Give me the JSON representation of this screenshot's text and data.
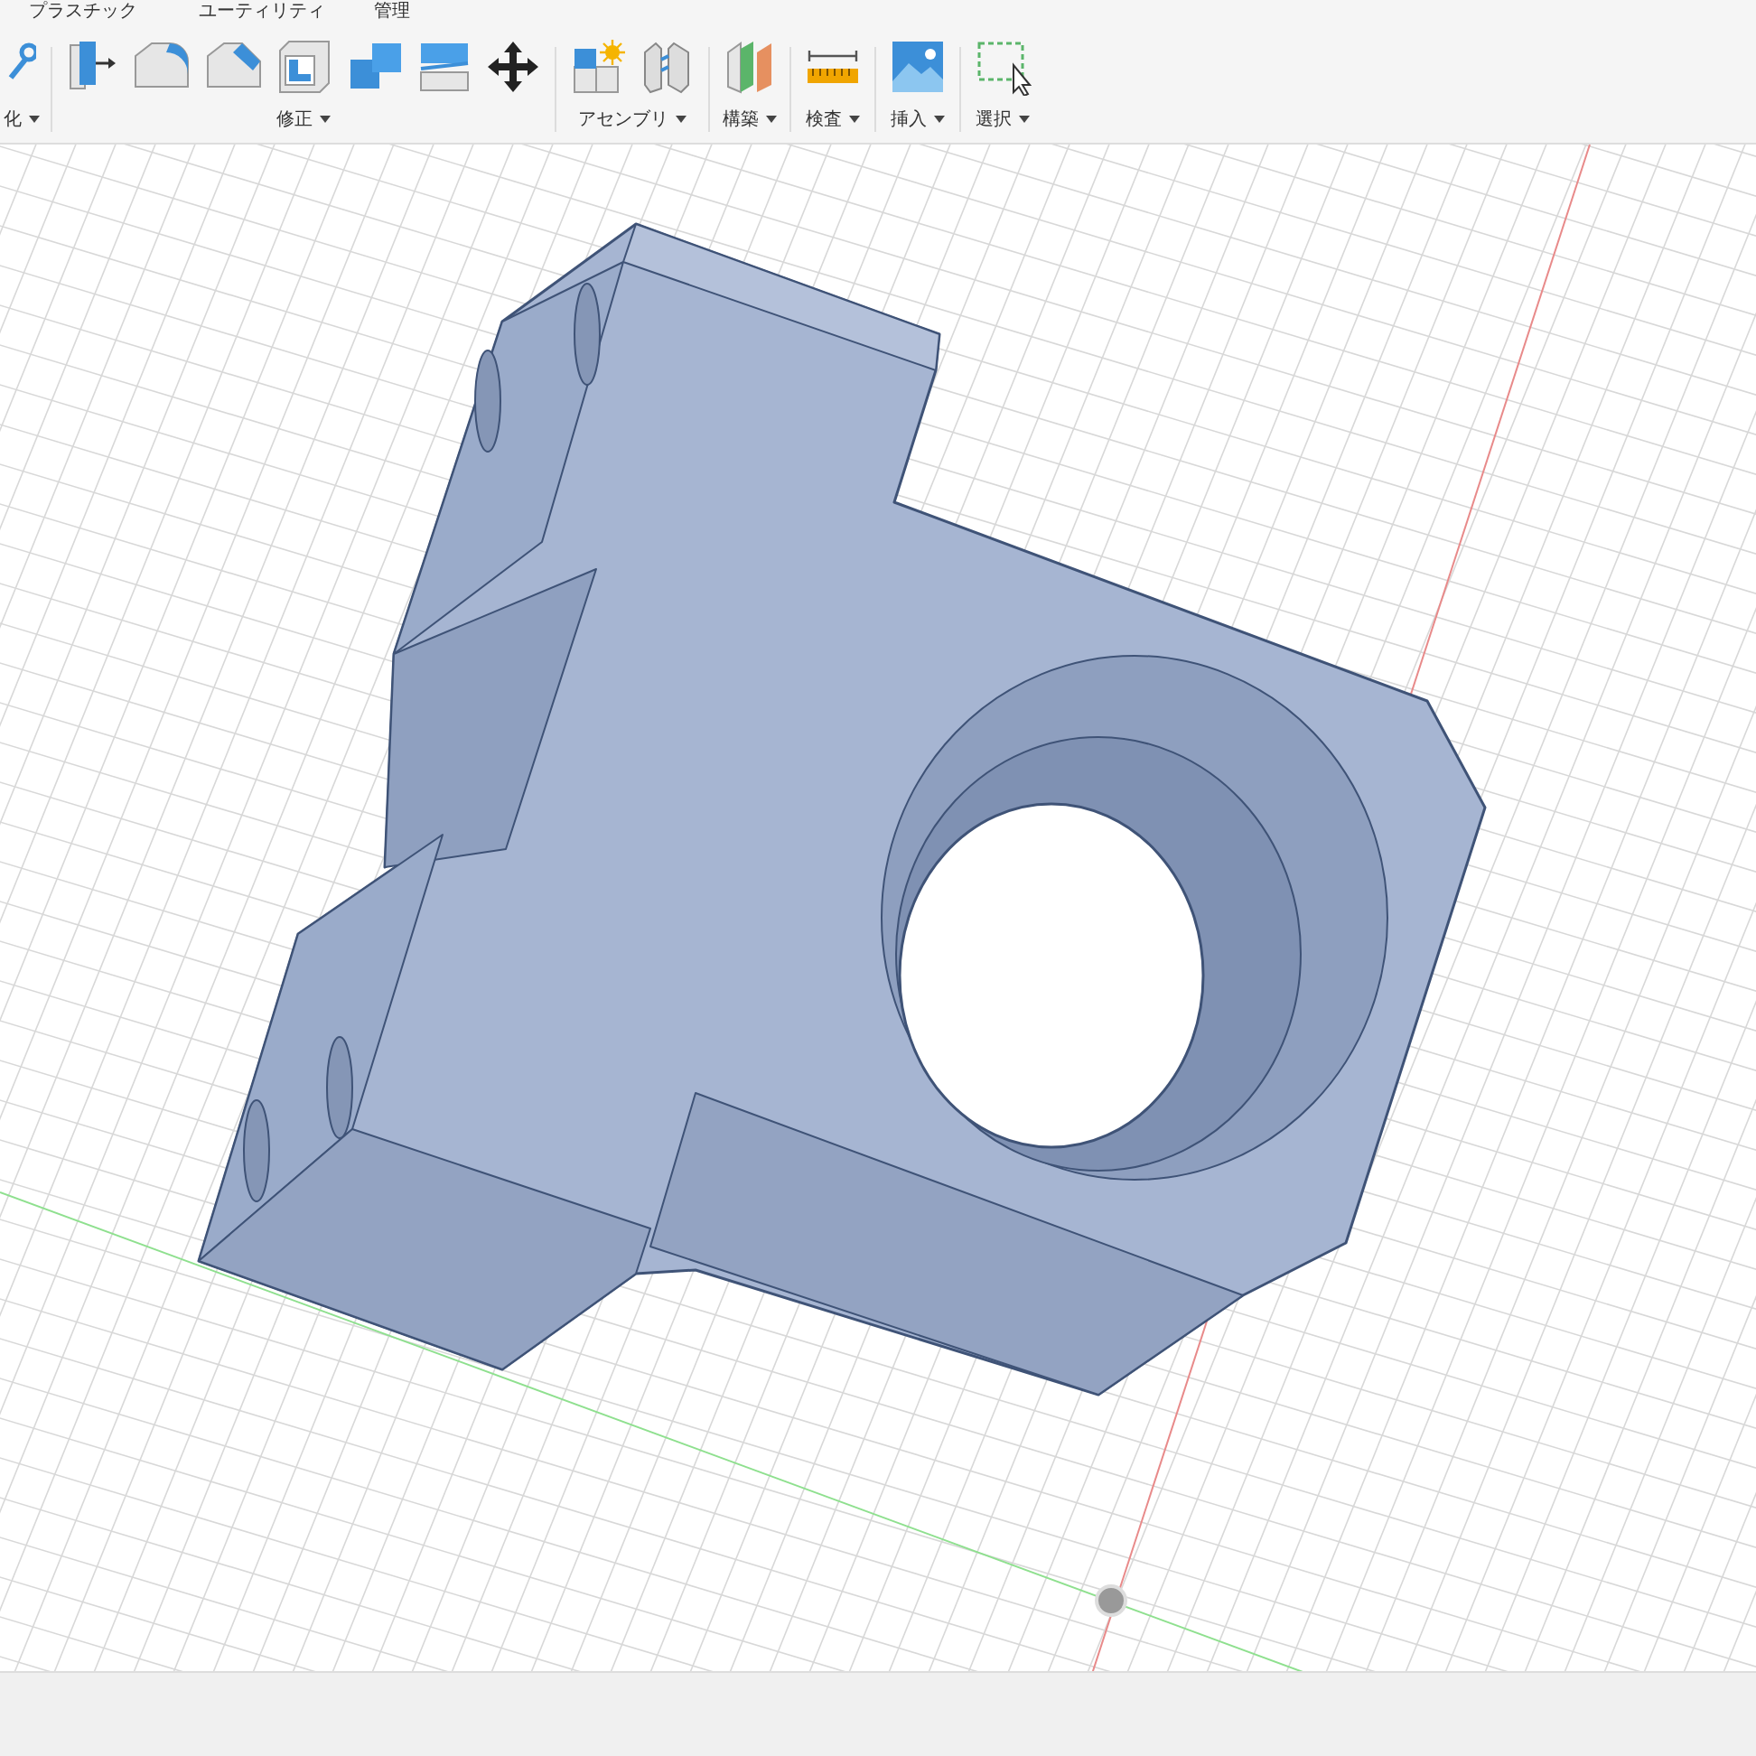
{
  "tabs": [
    {
      "label": "プラスチック"
    },
    {
      "label": "ユーティリティ"
    },
    {
      "label": "管理"
    }
  ],
  "toolbar_groups": [
    {
      "label": "化",
      "tools": [
        {
          "kind": "sketch"
        }
      ]
    },
    {
      "label": "修正",
      "tools": [
        {
          "kind": "presspull"
        },
        {
          "kind": "fillet"
        },
        {
          "kind": "chamfer"
        },
        {
          "kind": "shell"
        },
        {
          "kind": "combine"
        },
        {
          "kind": "split"
        },
        {
          "kind": "move"
        }
      ]
    },
    {
      "label": "アセンブリ",
      "tools": [
        {
          "kind": "component"
        },
        {
          "kind": "joint"
        }
      ]
    },
    {
      "label": "構築",
      "tools": [
        {
          "kind": "plane"
        }
      ]
    },
    {
      "label": "検査",
      "tools": [
        {
          "kind": "measure"
        }
      ]
    },
    {
      "label": "挿入",
      "tools": [
        {
          "kind": "image"
        }
      ]
    },
    {
      "label": "選択",
      "tools": [
        {
          "kind": "select"
        }
      ]
    }
  ]
}
